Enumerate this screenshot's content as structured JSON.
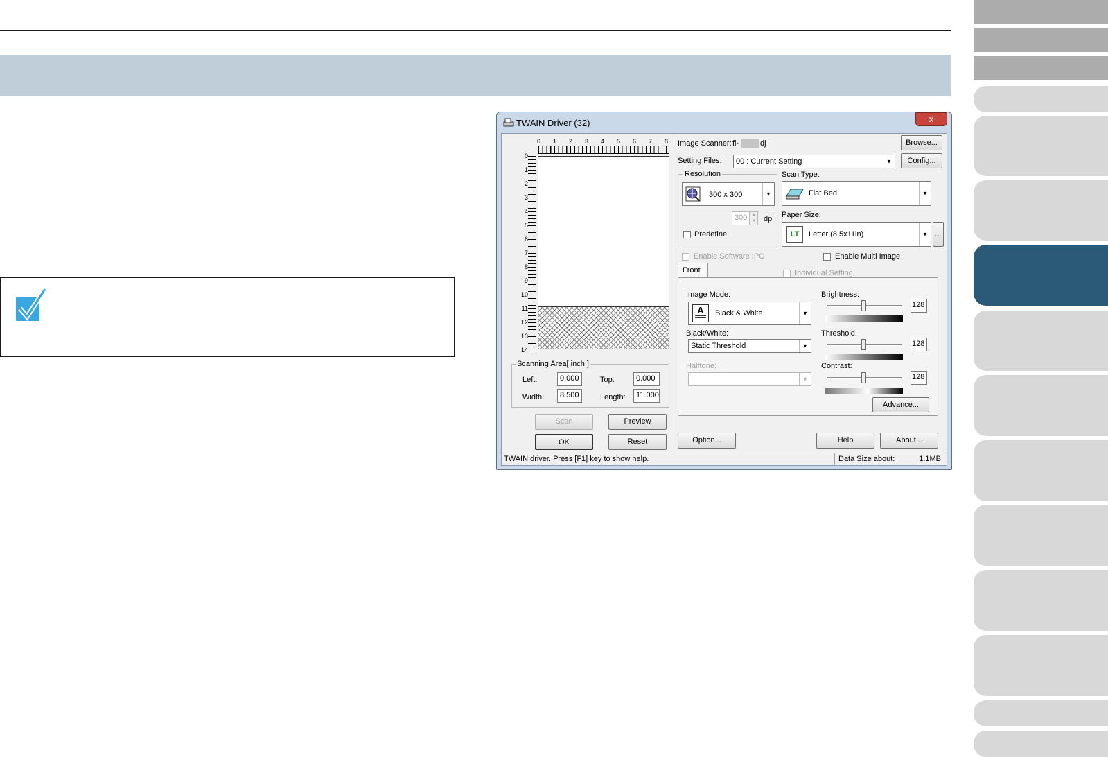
{
  "twain": {
    "title": "TWAIN Driver (32)",
    "close": "x",
    "ruler_top": [
      "0",
      "1",
      "2",
      "3",
      "4",
      "5",
      "6",
      "7",
      "8"
    ],
    "ruler_left": [
      "0",
      "1",
      "2",
      "3",
      "4",
      "5",
      "6",
      "7",
      "8",
      "9",
      "10",
      "11",
      "12",
      "13",
      "14"
    ],
    "scan_area": {
      "legend": "Scanning Area[ inch ]",
      "left_label": "Left:",
      "left_value": "0.000",
      "top_label": "Top:",
      "top_value": "0.000",
      "width_label": "Width:",
      "width_value": "8.500",
      "length_label": "Length:",
      "length_value": "11.000"
    },
    "buttons": {
      "scan": "Scan",
      "preview": "Preview",
      "ok": "OK",
      "reset": "Reset",
      "browse": "Browse...",
      "config": "Config...",
      "advance": "Advance...",
      "option": "Option...",
      "help": "Help",
      "about": "About...",
      "paper_more": "..."
    },
    "image_scanner_label": "Image Scanner:",
    "image_scanner_value": "fi-",
    "image_scanner_suffix": "dj",
    "setting_files_label": "Setting Files:",
    "setting_files_value": "00 : Current Setting",
    "resolution_label": "Resolution",
    "resolution_value": "300 x 300",
    "dpi_value": "300",
    "dpi_label": "dpi",
    "predefine_label": "Predefine",
    "scan_type_label": "Scan Type:",
    "scan_type_value": "Flat Bed",
    "paper_size_label": "Paper Size:",
    "paper_size_value": "Letter (8.5x11in)",
    "paper_icon_text": "LT",
    "enable_ipc_label": "Enable Software IPC",
    "enable_multi_label": "Enable Multi Image",
    "tab_front": "Front",
    "individual_setting_label": "Individual Setting",
    "image_mode_label": "Image Mode:",
    "image_mode_value": "Black & White",
    "bw_label": "Black/White:",
    "bw_value": "Static Threshold",
    "halftone_label": "Halftone:",
    "brightness_label": "Brightness:",
    "brightness_value": "128",
    "threshold_label": "Threshold:",
    "threshold_value": "128",
    "contrast_label": "Contrast:",
    "contrast_value": "128",
    "status_text": "TWAIN driver. Press [F1] key to show help.",
    "data_size_label": "Data Size about:",
    "data_size_value": "1.1MB"
  }
}
